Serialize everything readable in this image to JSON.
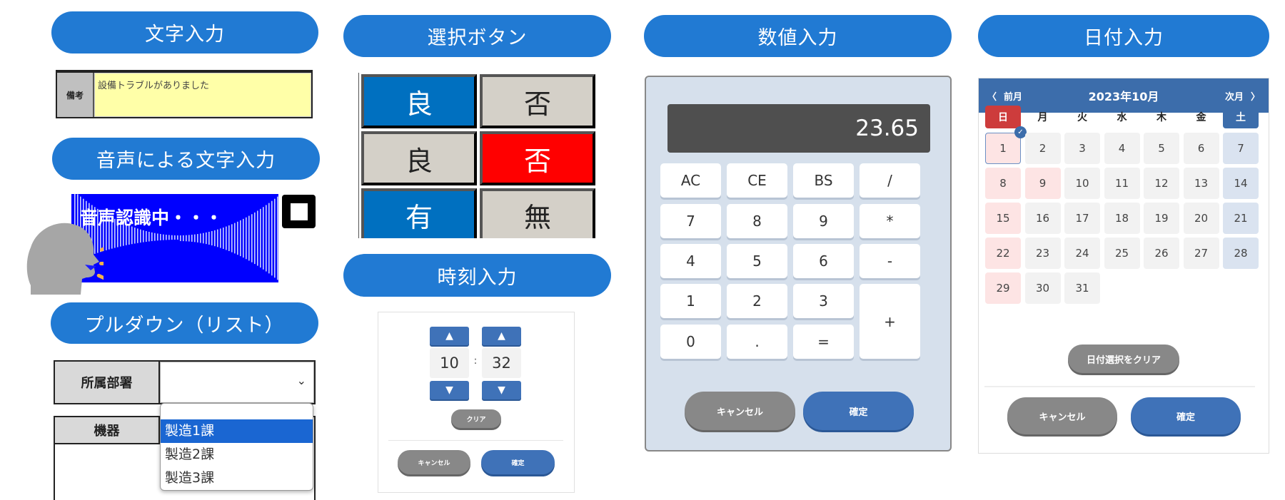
{
  "sections": {
    "text_input": "文字入力",
    "select_buttons": "選択ボタン",
    "numeric_input": "数値入力",
    "date_input": "日付入力",
    "voice_input": "音声による文字入力",
    "time_input": "時刻入力",
    "pulldown": "プルダウン（リスト）"
  },
  "memo": {
    "label": "備考",
    "value": "設備トラブルがありました"
  },
  "voice": {
    "status": "音声認識中・・・",
    "stop_icon": "stop-square-icon",
    "speaker_icon": "speaking-head-icon"
  },
  "select_buttons": {
    "rows": [
      [
        {
          "label": "良",
          "state": "selected-blue"
        },
        {
          "label": "否",
          "state": "unselected"
        }
      ],
      [
        {
          "label": "良",
          "state": "unselected"
        },
        {
          "label": "否",
          "state": "selected-red"
        }
      ],
      [
        {
          "label": "有",
          "state": "selected-blue"
        },
        {
          "label": "無",
          "state": "unselected"
        }
      ]
    ]
  },
  "pulldown": {
    "field_label": "所属部署",
    "value": "",
    "second_label": "機器",
    "options": [
      "",
      "製造1課",
      "製造2課",
      "製造3課"
    ],
    "highlighted": "製造1課",
    "chevron_icon": "chevron-down-icon"
  },
  "time": {
    "hour": "10",
    "minute": "32",
    "separator": ":",
    "up_icon": "▲",
    "down_icon": "▼",
    "clear_label": "クリア",
    "cancel_label": "キャンセル",
    "confirm_label": "確定"
  },
  "calculator": {
    "display": "23.65",
    "keys": [
      [
        "AC",
        "CE",
        "BS",
        "/"
      ],
      [
        "7",
        "8",
        "9",
        "*"
      ],
      [
        "4",
        "5",
        "6",
        "-"
      ],
      [
        "1",
        "2",
        "3",
        "+"
      ],
      [
        "0",
        ".",
        "="
      ]
    ],
    "cancel_label": "キャンセル",
    "confirm_label": "確定"
  },
  "calendar": {
    "prev_label": "前月",
    "next_label": "次月",
    "title": "2023年10月",
    "weekdays": [
      "日",
      "月",
      "火",
      "水",
      "木",
      "金",
      "土"
    ],
    "first_weekday": 0,
    "days_in_month": 31,
    "selected_day": 1,
    "holidays": [
      9
    ],
    "clear_label": "日付選択をクリア",
    "cancel_label": "キャンセル",
    "confirm_label": "確定"
  }
}
